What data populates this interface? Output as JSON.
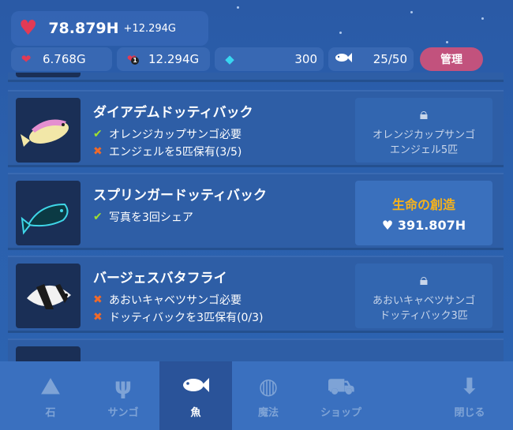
{
  "hud": {
    "life_total": "78.879H",
    "life_rate": "+12.294G",
    "stat_1": "6.768G",
    "stat_2": "12.294G",
    "gems": "300",
    "fish_count": "25/50",
    "manage_label": "管理",
    "stat_2_badge": "1"
  },
  "fish_list": [
    {
      "name": "ダイアデムドッティバック",
      "requirements": [
        {
          "status": "ok",
          "text": "オレンジカップサンゴ必要"
        },
        {
          "status": "ng",
          "text": "エンジェルを5匹保有(3/5)"
        }
      ],
      "locked": true,
      "unlock_line1": "オレンジカップサンゴ",
      "unlock_line2": "エンジェル5匹"
    },
    {
      "name": "スプリンガードッティバック",
      "requirements": [
        {
          "status": "ok",
          "text": "写真を3回シェア"
        }
      ],
      "locked": false,
      "action_label": "生命の創造",
      "cost": "391.807H"
    },
    {
      "name": "バージェスバタフライ",
      "requirements": [
        {
          "status": "ng",
          "text": "あおいキャベツサンゴ必要"
        },
        {
          "status": "ng",
          "text": "ドッティバックを3匹保有(0/3)"
        }
      ],
      "locked": true,
      "unlock_line1": "あおいキャベツサンゴ",
      "unlock_line2": "ドッティバック3匹"
    }
  ],
  "nav": {
    "tabs": [
      {
        "label": "石",
        "icon": "stone-icon"
      },
      {
        "label": "サンゴ",
        "icon": "coral-icon"
      },
      {
        "label": "魚",
        "icon": "fish-icon",
        "active": true
      },
      {
        "label": "魔法",
        "icon": "crystal-ball-icon"
      },
      {
        "label": "ショップ",
        "icon": "cart-icon"
      }
    ],
    "close_label": "閉じる"
  },
  "colors": {
    "ok": "#9ee02f",
    "ng": "#f06a2a",
    "accent": "#f6b21b",
    "heart": "#e23a55",
    "manage_button": "#c2527d"
  }
}
